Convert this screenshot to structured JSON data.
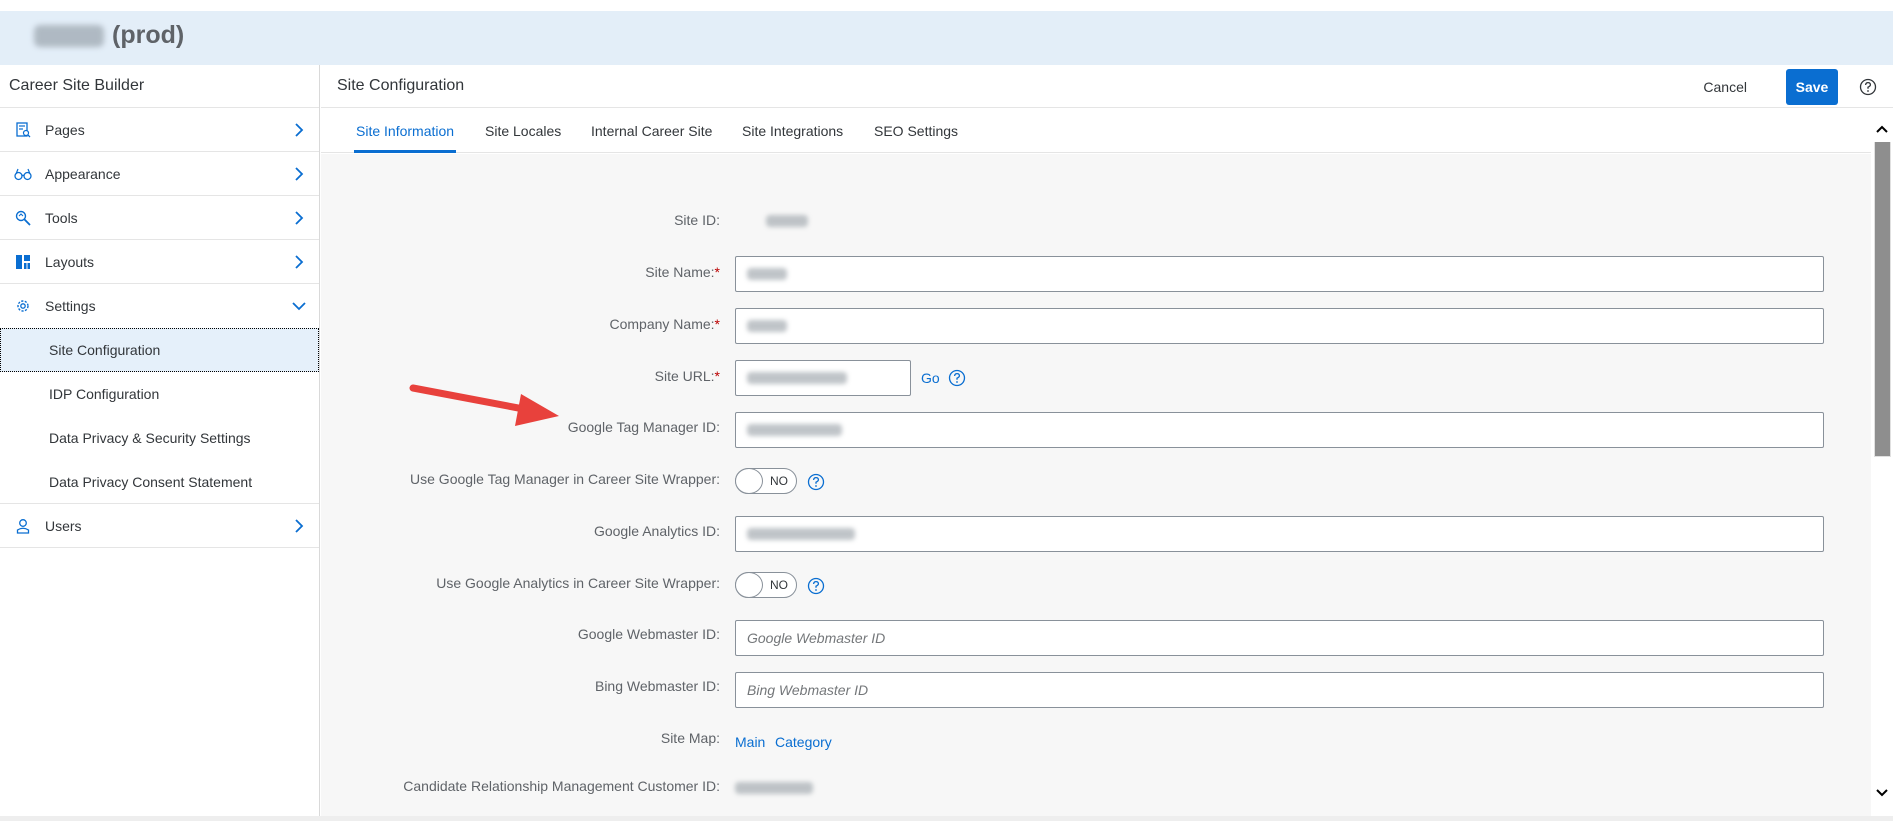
{
  "app": {
    "title_suffix": "(prod)"
  },
  "sidebar": {
    "title": "Career Site Builder",
    "items": [
      {
        "label": "Pages",
        "icon": "pages-icon"
      },
      {
        "label": "Appearance",
        "icon": "glasses-icon"
      },
      {
        "label": "Tools",
        "icon": "tools-icon"
      },
      {
        "label": "Layouts",
        "icon": "layouts-icon"
      },
      {
        "label": "Settings",
        "icon": "gear-icon"
      }
    ],
    "settings_children": [
      "Site Configuration",
      "IDP Configuration",
      "Data Privacy & Security Settings",
      "Data Privacy Consent Statement"
    ],
    "selected": "Site Configuration",
    "users": {
      "label": "Users",
      "icon": "user-icon"
    }
  },
  "header": {
    "title": "Site Configuration",
    "cancel": "Cancel",
    "save": "Save"
  },
  "tabs": [
    "Site Information",
    "Site Locales",
    "Internal Career Site",
    "Site Integrations",
    "SEO Settings"
  ],
  "active_tab": "Site Information",
  "form": {
    "site_id_label": "Site ID:",
    "site_name_label": "Site Name:",
    "company_name_label": "Company Name:",
    "site_url_label": "Site URL:",
    "go_link": "Go",
    "gtm_label": "Google Tag Manager ID:",
    "gtm_wrapper_label": "Use Google Tag Manager in Career Site Wrapper:",
    "ga_label": "Google Analytics ID:",
    "ga_wrapper_label": "Use Google Analytics in Career Site Wrapper:",
    "toggle_off": "NO",
    "google_webmaster_label": "Google Webmaster ID:",
    "google_webmaster_placeholder": "Google Webmaster ID",
    "bing_webmaster_label": "Bing Webmaster ID:",
    "bing_webmaster_placeholder": "Bing Webmaster ID",
    "site_map_label": "Site Map:",
    "site_map_main": "Main",
    "site_map_category": "Category",
    "crm_label": "Candidate Relationship Management Customer ID:",
    "required_mark": "*"
  },
  "annotation": {
    "arrow_color": "#e8413c"
  },
  "colors": {
    "accent": "#0a6ed1",
    "selected_bg": "#e5f0fa",
    "top_band": "#e3eef8"
  }
}
